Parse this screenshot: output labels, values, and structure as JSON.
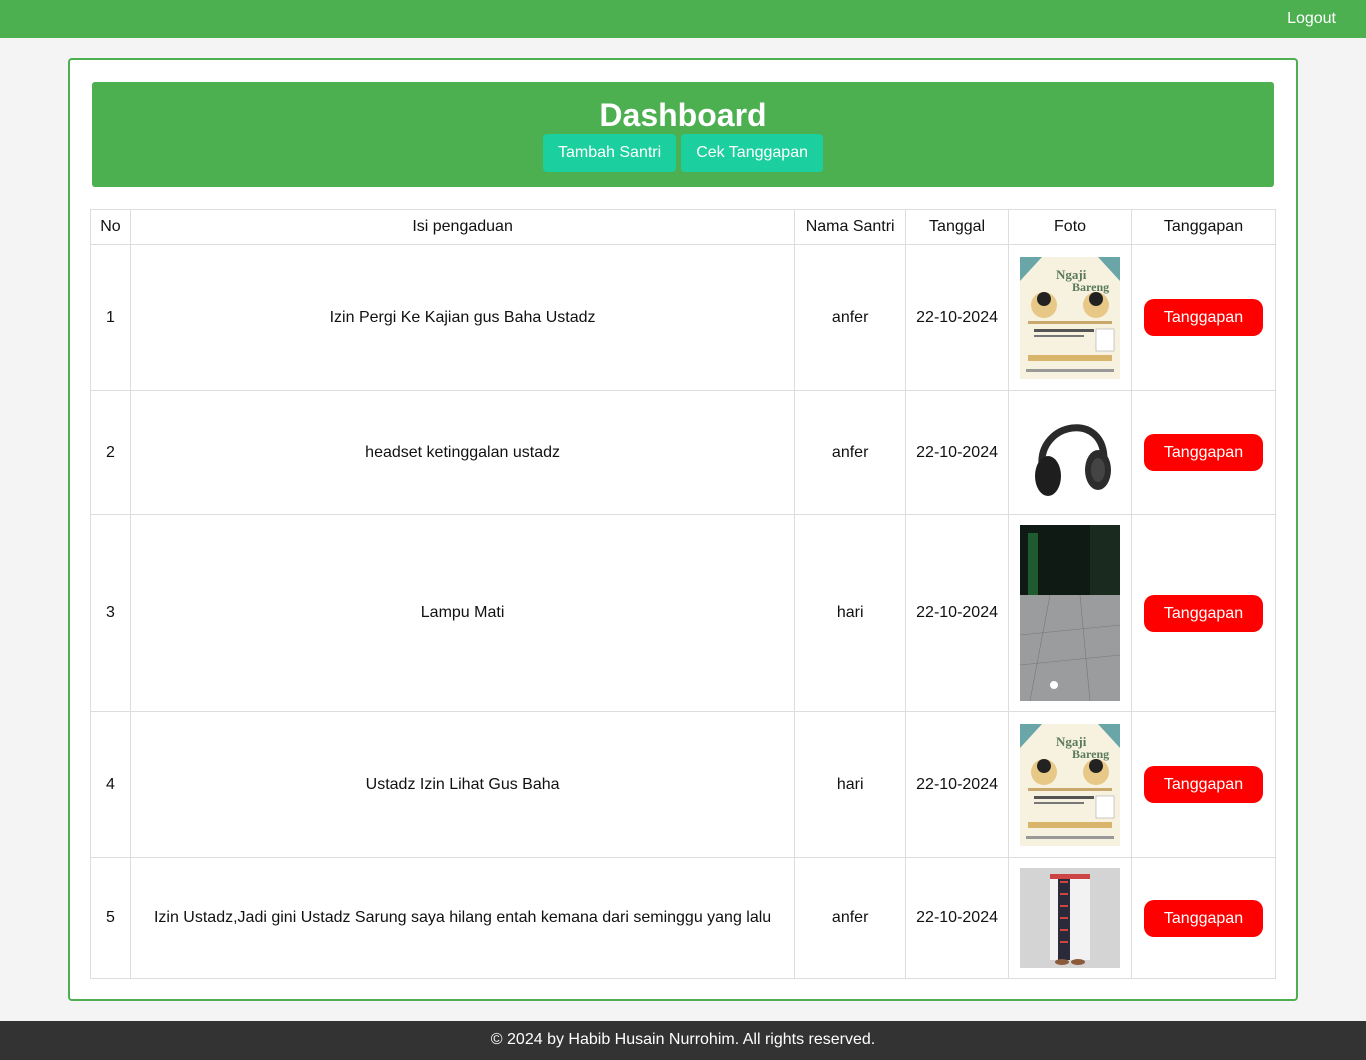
{
  "nav": {
    "logout_label": "Logout"
  },
  "header": {
    "title": "Dashboard",
    "buttons": {
      "tambah_santri": "Tambah Santri",
      "cek_tanggapan": "Cek Tanggapan"
    }
  },
  "table": {
    "headers": [
      "No",
      "Isi pengaduan",
      "Nama Santri",
      "Tanggal",
      "Foto",
      "Tanggapan"
    ],
    "rows": [
      {
        "no": "1",
        "isi": "Izin Pergi Ke Kajian gus Baha Ustadz",
        "nama": "anfer",
        "tanggal": "22-10-2024",
        "foto": "poster-image",
        "poster_title": "Ngaji",
        "poster_subtitle": "Bareng",
        "action": "Tanggapan"
      },
      {
        "no": "2",
        "isi": "headset ketinggalan ustadz",
        "nama": "anfer",
        "tanggal": "22-10-2024",
        "foto": "headphone-image",
        "action": "Tanggapan"
      },
      {
        "no": "3",
        "isi": "Lampu Mati",
        "nama": "hari",
        "tanggal": "22-10-2024",
        "foto": "hallway-image",
        "action": "Tanggapan"
      },
      {
        "no": "4",
        "isi": "Ustadz Izin Lihat Gus Baha",
        "nama": "hari",
        "tanggal": "22-10-2024",
        "foto": "poster-image",
        "poster_title": "Ngaji",
        "poster_subtitle": "Bareng",
        "action": "Tanggapan"
      },
      {
        "no": "5",
        "isi": "Izin Ustadz,Jadi gini Ustadz Sarung saya hilang entah kemana dari seminggu yang lalu",
        "nama": "anfer",
        "tanggal": "22-10-2024",
        "foto": "sarong-image",
        "action": "Tanggapan"
      }
    ]
  },
  "footer": {
    "text": "© 2024 by Habib Husain Nurrohim. All rights reserved."
  },
  "colors": {
    "primary_green": "#4caf50",
    "teal_button": "#1ccf9e",
    "red_button": "#ff0000",
    "footer_bg": "#333333"
  }
}
